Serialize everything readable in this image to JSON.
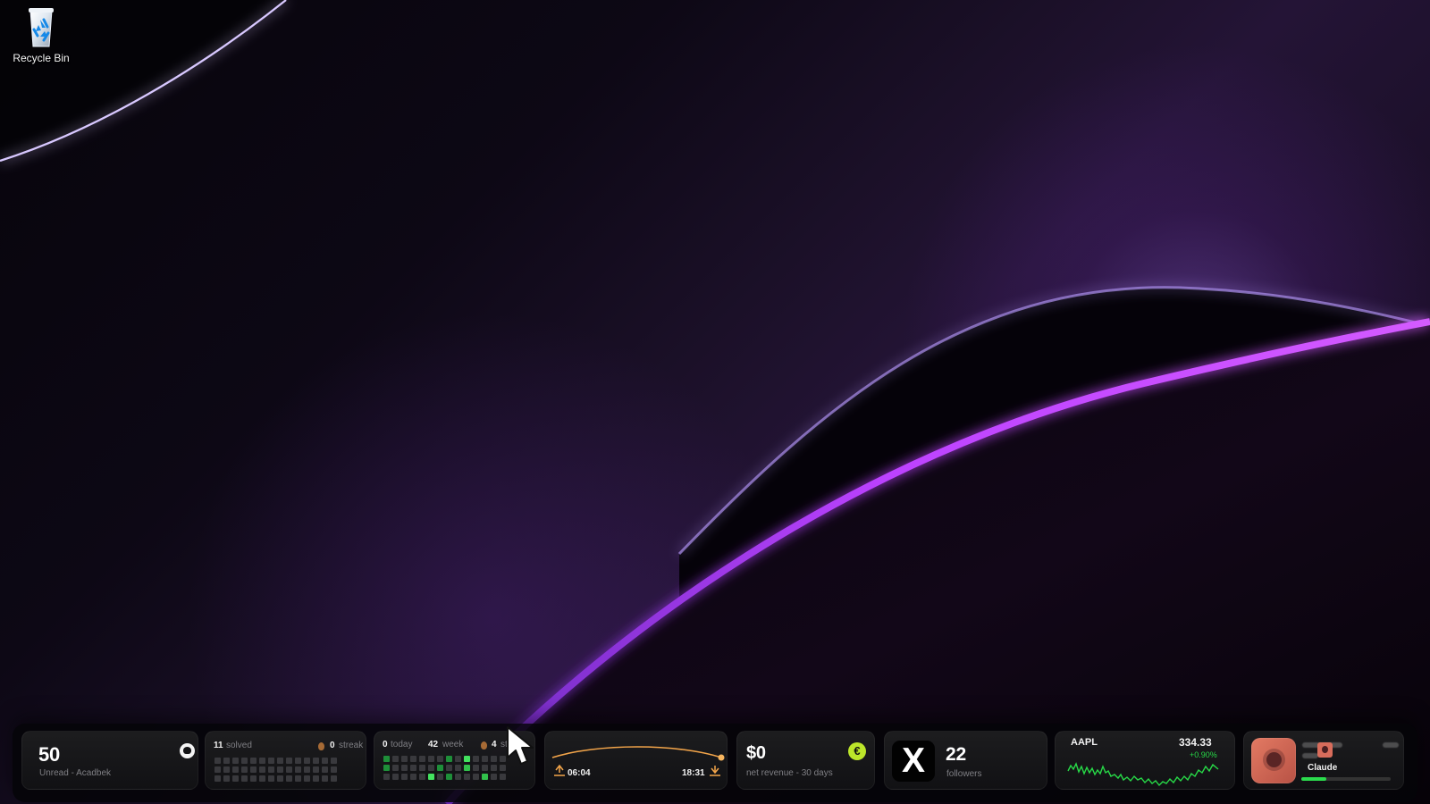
{
  "desktop": {
    "recycle_bin_label": "Recycle Bin"
  },
  "widgets": {
    "github": {
      "count": "50",
      "subtitle": "Unread - Acadbek",
      "icon": "github-icon"
    },
    "leetcode": {
      "solved_number": "11",
      "solved_label": "solved",
      "streak_number": "0",
      "streak_label": "streak"
    },
    "habit": {
      "today_number": "0",
      "today_label": "today",
      "week_number": "42",
      "week_label": "week",
      "streak_number": "4",
      "streak_label": "streak"
    },
    "sun": {
      "sunrise": "06:04",
      "sunset": "18:31",
      "sunrise_icon": "sunrise-icon",
      "sunset_icon": "sunset-icon"
    },
    "revenue": {
      "amount": "$0",
      "label": "net revenue - 30 days",
      "icon": "revenue-badge-icon"
    },
    "x": {
      "logo": "X",
      "followers": "22",
      "label": "followers"
    },
    "stock": {
      "symbol": "AAPL",
      "price": "334.33",
      "change": "+0.90%",
      "colors": {
        "up": "#27d947"
      }
    },
    "claude": {
      "label": "Claude",
      "usage_fraction": 0.28,
      "icon": "claude-icon"
    }
  },
  "theme": {
    "accent_purple": "#b845ff",
    "widget_background": "#1b1b1e",
    "muted_text": "#7f7f84",
    "green": "#31c04b",
    "revenue_green": "#bce62a",
    "sun_orange": "#f3a54a"
  }
}
